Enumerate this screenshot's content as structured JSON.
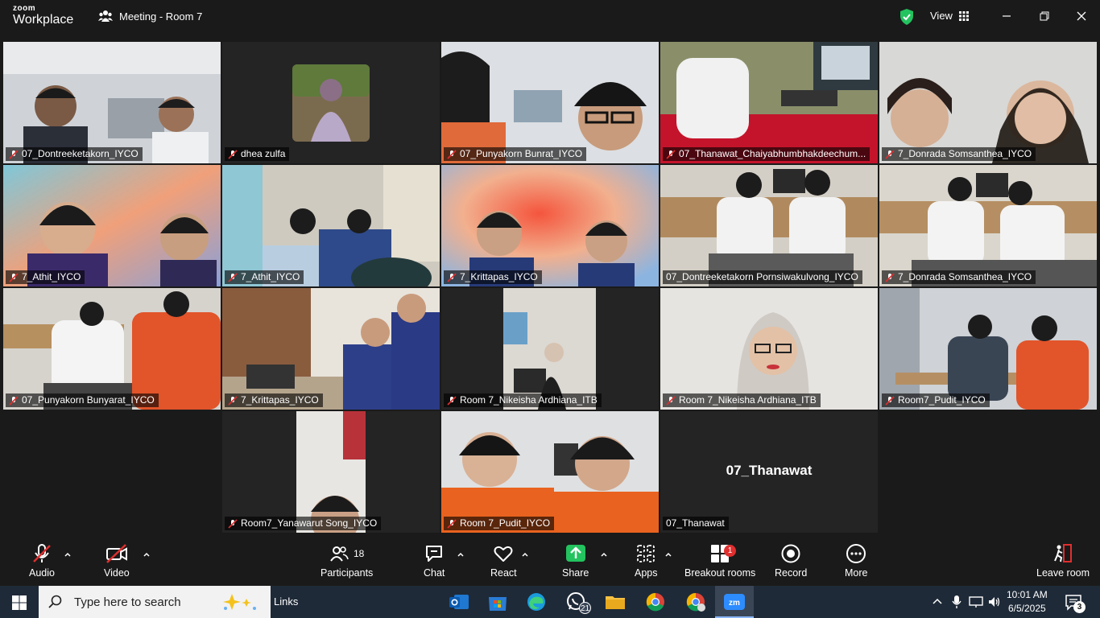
{
  "titlebar": {
    "brand_top": "zoom",
    "brand_bottom": "Workplace",
    "meeting_title": "Meeting - Room 7",
    "view_label": "View"
  },
  "tiles": [
    {
      "name": "07_Dontreeketakorn_IYCO"
    },
    {
      "name": "dhea zulfa"
    },
    {
      "name": "07_Punyakorn Bunrat_IYCO"
    },
    {
      "name": "07_Thanawat_Chaiyabhumbhakdeechum..."
    },
    {
      "name": "7_Donrada Somsanthea_IYCO"
    },
    {
      "name": "7_Athit_IYCO"
    },
    {
      "name": "7_Athit_IYCO"
    },
    {
      "name": "7_Krittapas_IYCO"
    },
    {
      "name": "07_Dontreeketakorn Pornsiwakulvong_IYCO"
    },
    {
      "name": "7_Donrada Somsanthea_IYCO"
    },
    {
      "name": "07_Punyakorn Bunyarat_IYCO"
    },
    {
      "name": "7_Krittapas_IYCO"
    },
    {
      "name": "Room 7_Nikeisha Ardhiana_ITB"
    },
    {
      "name": "Room 7_Nikeisha Ardhiana_ITB"
    },
    {
      "name": "Room7_Pudit_IYCO"
    },
    {
      "name": "Room7_Yanawarut Song_IYCO"
    },
    {
      "name": "Room 7_Pudit_IYCO"
    },
    {
      "name": "07_Thanawat",
      "display_name": "07_Thanawat"
    }
  ],
  "toolbar": {
    "audio": "Audio",
    "video": "Video",
    "participants": "Participants",
    "participants_count": "18",
    "chat": "Chat",
    "react": "React",
    "share": "Share",
    "apps": "Apps",
    "breakout": "Breakout rooms",
    "breakout_badge": "1",
    "record": "Record",
    "more": "More",
    "leave": "Leave room"
  },
  "taskbar": {
    "search_placeholder": "Type here to search",
    "links": "Links",
    "whatsapp_badge": "21",
    "time": "10:01 AM",
    "date": "6/5/2025",
    "notification_count": "3"
  },
  "colors": {
    "active_speaker": "#2ecc71",
    "share_green": "#23c35f",
    "badge_red": "#e02f2f",
    "mic_off_red": "#e02f2f"
  }
}
